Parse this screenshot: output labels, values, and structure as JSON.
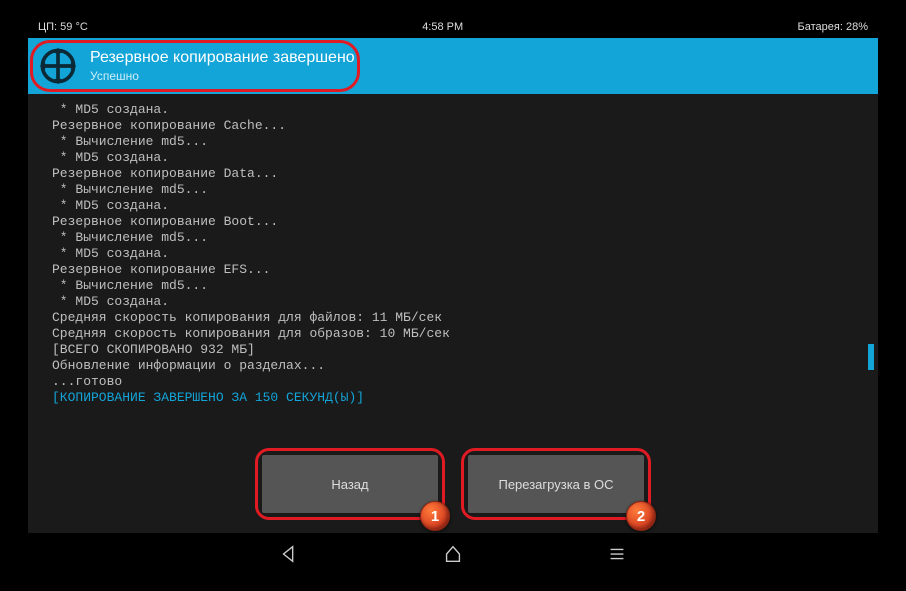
{
  "statusbar": {
    "cpu": "ЦП: 59 °C",
    "time": "4:58 PM",
    "battery": "Батарея: 28%"
  },
  "header": {
    "title": "Резервное копирование завершено",
    "subtitle": "Успешно"
  },
  "log": {
    "lines": [
      " * MD5 создана.",
      "Резервное копирование Cache...",
      " * Вычисление md5...",
      " * MD5 создана.",
      "Резервное копирование Data...",
      " * Вычисление md5...",
      " * MD5 создана.",
      "Резервное копирование Boot...",
      " * Вычисление md5...",
      " * MD5 создана.",
      "Резервное копирование EFS...",
      " * Вычисление md5...",
      " * MD5 создана.",
      "Средняя скорость копирования для файлов: 11 МБ/сек",
      "Средняя скорость копирования для образов: 10 МБ/сек",
      "[ВСЕГО СКОПИРОВАНО 932 МБ]",
      "Обновление информации о разделах...",
      "...готово"
    ],
    "final": "[КОПИРОВАНИЕ ЗАВЕРШЕНО ЗА 150 СЕКУНД(Ы)]"
  },
  "buttons": {
    "back": "Назад",
    "reboot": "Перезагрузка в ОС"
  },
  "badges": {
    "one": "1",
    "two": "2"
  }
}
